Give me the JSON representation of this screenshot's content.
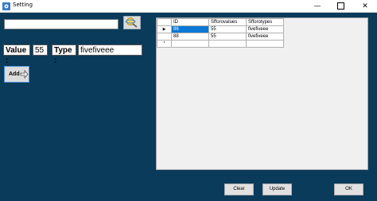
{
  "window": {
    "title": "Setting",
    "minimize_glyph": "—",
    "close_glyph": "✕"
  },
  "search": {
    "value": "",
    "button_icon": "search-icon"
  },
  "form": {
    "value_label": "Value :",
    "value": "55",
    "type_label": "Type :",
    "type_value": "fivefiveee"
  },
  "add_button": {
    "label": "Add",
    "icon": "arrow-right-icon"
  },
  "grid": {
    "columns": [
      "ID",
      "Sfforovalues",
      "Sfforotypes"
    ],
    "rows": [
      {
        "indicator": "▶",
        "id": "86",
        "value": "55",
        "type": "fivefiveee"
      },
      {
        "indicator": "",
        "id": "88",
        "value": "55",
        "type": "fivefiveee"
      }
    ],
    "new_row_indicator": "*"
  },
  "buttons": {
    "clear": "Clear",
    "update": "Update",
    "ok": "OK"
  }
}
